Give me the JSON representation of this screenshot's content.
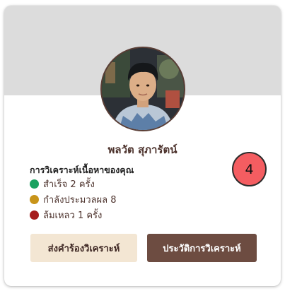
{
  "profile": {
    "name": "พลวัต สุภารัตน์",
    "avatar_icon": "user-photo"
  },
  "analysis": {
    "title": "การวิเคราะห์เนื้อหาของคุณ",
    "success": {
      "label": "สำเร็จ 2 ครั้ง",
      "color": "#1aa260"
    },
    "processing": {
      "label": "กำลังประมวลผล 8",
      "color": "#c8941a"
    },
    "failed": {
      "label": "ล้มเหลว 1 ครั้ง",
      "color": "#a61c1c"
    }
  },
  "badge": {
    "count": "4",
    "color": "#f45d61"
  },
  "actions": {
    "request_label": "ส่งคำร้องวิเคราะห์",
    "history_label": "ประวัติการวิเคราะห์"
  },
  "colors": {
    "header_bg": "#dcdcdc",
    "accent_brown": "#6d4c41",
    "accent_cream": "#f3e6d3"
  }
}
